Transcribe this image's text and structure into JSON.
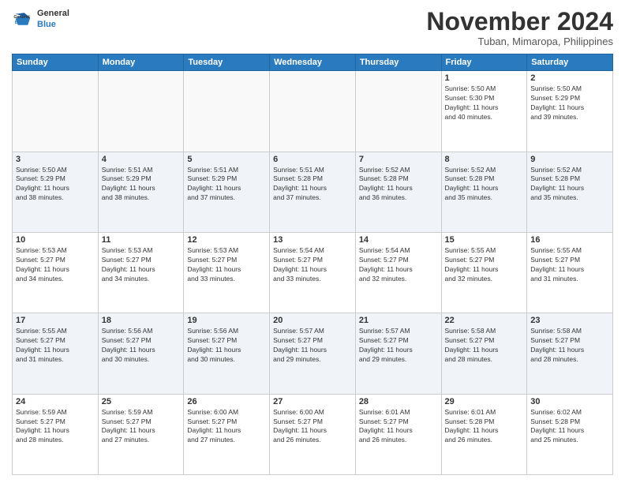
{
  "header": {
    "logo_line1": "General",
    "logo_line2": "Blue",
    "month": "November 2024",
    "location": "Tuban, Mimaropa, Philippines"
  },
  "weekdays": [
    "Sunday",
    "Monday",
    "Tuesday",
    "Wednesday",
    "Thursday",
    "Friday",
    "Saturday"
  ],
  "weeks": [
    [
      {
        "day": "",
        "info": ""
      },
      {
        "day": "",
        "info": ""
      },
      {
        "day": "",
        "info": ""
      },
      {
        "day": "",
        "info": ""
      },
      {
        "day": "",
        "info": ""
      },
      {
        "day": "1",
        "info": "Sunrise: 5:50 AM\nSunset: 5:30 PM\nDaylight: 11 hours\nand 40 minutes."
      },
      {
        "day": "2",
        "info": "Sunrise: 5:50 AM\nSunset: 5:29 PM\nDaylight: 11 hours\nand 39 minutes."
      }
    ],
    [
      {
        "day": "3",
        "info": "Sunrise: 5:50 AM\nSunset: 5:29 PM\nDaylight: 11 hours\nand 38 minutes."
      },
      {
        "day": "4",
        "info": "Sunrise: 5:51 AM\nSunset: 5:29 PM\nDaylight: 11 hours\nand 38 minutes."
      },
      {
        "day": "5",
        "info": "Sunrise: 5:51 AM\nSunset: 5:29 PM\nDaylight: 11 hours\nand 37 minutes."
      },
      {
        "day": "6",
        "info": "Sunrise: 5:51 AM\nSunset: 5:28 PM\nDaylight: 11 hours\nand 37 minutes."
      },
      {
        "day": "7",
        "info": "Sunrise: 5:52 AM\nSunset: 5:28 PM\nDaylight: 11 hours\nand 36 minutes."
      },
      {
        "day": "8",
        "info": "Sunrise: 5:52 AM\nSunset: 5:28 PM\nDaylight: 11 hours\nand 35 minutes."
      },
      {
        "day": "9",
        "info": "Sunrise: 5:52 AM\nSunset: 5:28 PM\nDaylight: 11 hours\nand 35 minutes."
      }
    ],
    [
      {
        "day": "10",
        "info": "Sunrise: 5:53 AM\nSunset: 5:27 PM\nDaylight: 11 hours\nand 34 minutes."
      },
      {
        "day": "11",
        "info": "Sunrise: 5:53 AM\nSunset: 5:27 PM\nDaylight: 11 hours\nand 34 minutes."
      },
      {
        "day": "12",
        "info": "Sunrise: 5:53 AM\nSunset: 5:27 PM\nDaylight: 11 hours\nand 33 minutes."
      },
      {
        "day": "13",
        "info": "Sunrise: 5:54 AM\nSunset: 5:27 PM\nDaylight: 11 hours\nand 33 minutes."
      },
      {
        "day": "14",
        "info": "Sunrise: 5:54 AM\nSunset: 5:27 PM\nDaylight: 11 hours\nand 32 minutes."
      },
      {
        "day": "15",
        "info": "Sunrise: 5:55 AM\nSunset: 5:27 PM\nDaylight: 11 hours\nand 32 minutes."
      },
      {
        "day": "16",
        "info": "Sunrise: 5:55 AM\nSunset: 5:27 PM\nDaylight: 11 hours\nand 31 minutes."
      }
    ],
    [
      {
        "day": "17",
        "info": "Sunrise: 5:55 AM\nSunset: 5:27 PM\nDaylight: 11 hours\nand 31 minutes."
      },
      {
        "day": "18",
        "info": "Sunrise: 5:56 AM\nSunset: 5:27 PM\nDaylight: 11 hours\nand 30 minutes."
      },
      {
        "day": "19",
        "info": "Sunrise: 5:56 AM\nSunset: 5:27 PM\nDaylight: 11 hours\nand 30 minutes."
      },
      {
        "day": "20",
        "info": "Sunrise: 5:57 AM\nSunset: 5:27 PM\nDaylight: 11 hours\nand 29 minutes."
      },
      {
        "day": "21",
        "info": "Sunrise: 5:57 AM\nSunset: 5:27 PM\nDaylight: 11 hours\nand 29 minutes."
      },
      {
        "day": "22",
        "info": "Sunrise: 5:58 AM\nSunset: 5:27 PM\nDaylight: 11 hours\nand 28 minutes."
      },
      {
        "day": "23",
        "info": "Sunrise: 5:58 AM\nSunset: 5:27 PM\nDaylight: 11 hours\nand 28 minutes."
      }
    ],
    [
      {
        "day": "24",
        "info": "Sunrise: 5:59 AM\nSunset: 5:27 PM\nDaylight: 11 hours\nand 28 minutes."
      },
      {
        "day": "25",
        "info": "Sunrise: 5:59 AM\nSunset: 5:27 PM\nDaylight: 11 hours\nand 27 minutes."
      },
      {
        "day": "26",
        "info": "Sunrise: 6:00 AM\nSunset: 5:27 PM\nDaylight: 11 hours\nand 27 minutes."
      },
      {
        "day": "27",
        "info": "Sunrise: 6:00 AM\nSunset: 5:27 PM\nDaylight: 11 hours\nand 26 minutes."
      },
      {
        "day": "28",
        "info": "Sunrise: 6:01 AM\nSunset: 5:27 PM\nDaylight: 11 hours\nand 26 minutes."
      },
      {
        "day": "29",
        "info": "Sunrise: 6:01 AM\nSunset: 5:28 PM\nDaylight: 11 hours\nand 26 minutes."
      },
      {
        "day": "30",
        "info": "Sunrise: 6:02 AM\nSunset: 5:28 PM\nDaylight: 11 hours\nand 25 minutes."
      }
    ]
  ]
}
